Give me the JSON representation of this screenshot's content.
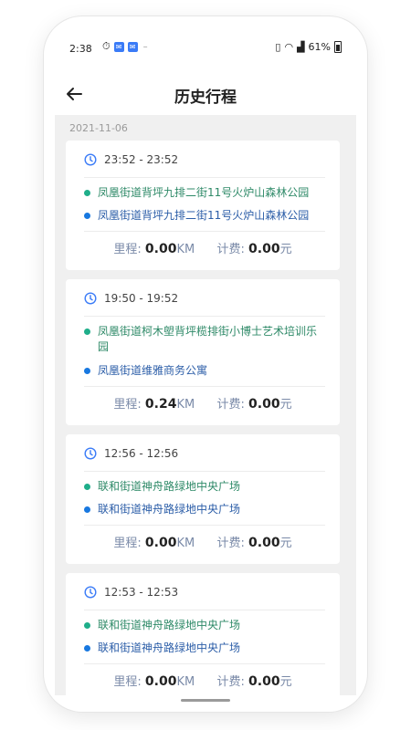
{
  "status_bar": {
    "time": "2:38",
    "battery": "61%"
  },
  "header": {
    "title": "历史行程"
  },
  "date_group": "2021-11-06",
  "stat_labels": {
    "mileage": "里程:",
    "mileage_unit": "KM",
    "fee": "计费:",
    "fee_unit": "元"
  },
  "trips": [
    {
      "time": "23:52 - 23:52",
      "start": "凤凰街道背坪九排二街11号火炉山森林公园",
      "end": "凤凰街道背坪九排二街11号火炉山森林公园",
      "mileage": "0.00",
      "fee": "0.00"
    },
    {
      "time": "19:50 - 19:52",
      "start": "凤凰街道柯木塱背坪榄排街小博士艺术培训乐园",
      "end": "凤凰街道维雅商务公寓",
      "mileage": "0.24",
      "fee": "0.00"
    },
    {
      "time": "12:56 - 12:56",
      "start": "联和街道神舟路绿地中央广场",
      "end": "联和街道神舟路绿地中央广场",
      "mileage": "0.00",
      "fee": "0.00"
    },
    {
      "time": "12:53 - 12:53",
      "start": "联和街道神舟路绿地中央广场",
      "end": "联和街道神舟路绿地中央广场",
      "mileage": "0.00",
      "fee": "0.00"
    }
  ],
  "icons": {
    "back": "arrow-left-icon",
    "clock": "clock-icon",
    "accent_color": "#3a7bf7",
    "start_dot_color": "#1fae8a",
    "end_dot_color": "#1878e0"
  }
}
